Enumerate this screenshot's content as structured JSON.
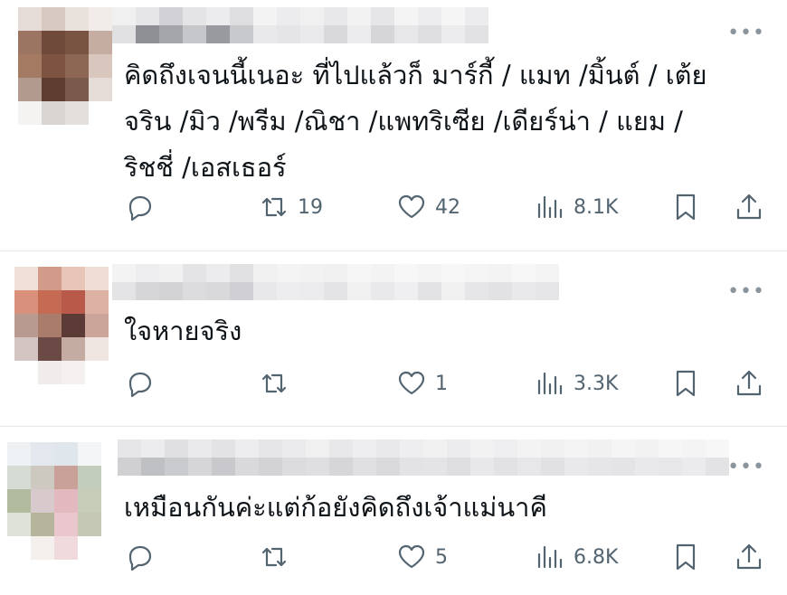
{
  "replies": [
    {
      "text": "คิดถึงเจนนี้เนอะ ที่ไปแล้วก็ มาร์กี้ / แมท /มิ้นต์ / เต้ย จริน /มิว /พรีม /ณิชา /แพทริเซีย /เดียร์น่า / แยม / ริชชี่ /เอสเธอร์",
      "lines": [
        "คิดถึงเจนนี้เนอะ ที่ไปแล้วก็ มาร์กี้ / แมท /มิ้นต์ / เต้ย",
        "จริน /มิว /พรีม /ณิชา /แพทริเซีย /เดียร์น่า / แยม /",
        "ริชชี่ /เอสเธอร์"
      ],
      "retweets": "19",
      "likes": "42",
      "views": "8.1K"
    },
    {
      "text": "ใจหายจริง",
      "lines": [
        "ใจหายจริง"
      ],
      "retweets": "",
      "likes": "1",
      "views": "3.3K"
    },
    {
      "text": "เหมือนกันค่ะแต่ก้อยังคิดถึงเจ้าแม่นาคี",
      "lines": [
        "เหมือนกันค่ะแต่ก้อยังคิดถึงเจ้าแม่นาคี"
      ],
      "retweets": "",
      "likes": "5",
      "views": "6.8K"
    }
  ],
  "more_label": "•••",
  "icons": {
    "reply": "reply-icon",
    "retweet": "retweet-icon",
    "like": "heart-icon",
    "views": "views-chart-icon",
    "bookmark": "bookmark-icon",
    "share": "share-icon"
  },
  "colors": {
    "text": "#0f1419",
    "secondary": "#536471",
    "divider": "#e6e9ec"
  }
}
